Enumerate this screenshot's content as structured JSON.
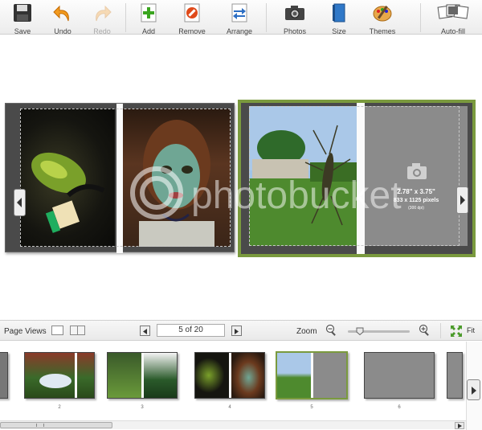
{
  "toolbar": {
    "save": "Save",
    "undo": "Undo",
    "redo": "Redo",
    "add": "Add",
    "remove": "Remove",
    "arrange": "Arrange",
    "photos": "Photos",
    "size": "Size",
    "themes": "Themes",
    "autofill": "Auto-fill"
  },
  "placeholder": {
    "dimensions": "2.78\" x 3.75\"",
    "pixels": "833 x 1125 pixels",
    "dpi": "(300 dpi)"
  },
  "watermark": "photobucket",
  "page_views": {
    "label": "Page Views",
    "page_indicator": "5 of 20",
    "zoom_label": "Zoom",
    "fit_label": "Fit",
    "zoom_level": 0.2
  },
  "thumbnails": [
    {
      "num": "2"
    },
    {
      "num": "3"
    },
    {
      "num": "4"
    },
    {
      "num": "5",
      "selected": true
    },
    {
      "num": "6"
    }
  ],
  "colors": {
    "selection": "#7a9a3e",
    "placeholder": "#8b8b8b",
    "page_bg": "#4a4a4a"
  }
}
